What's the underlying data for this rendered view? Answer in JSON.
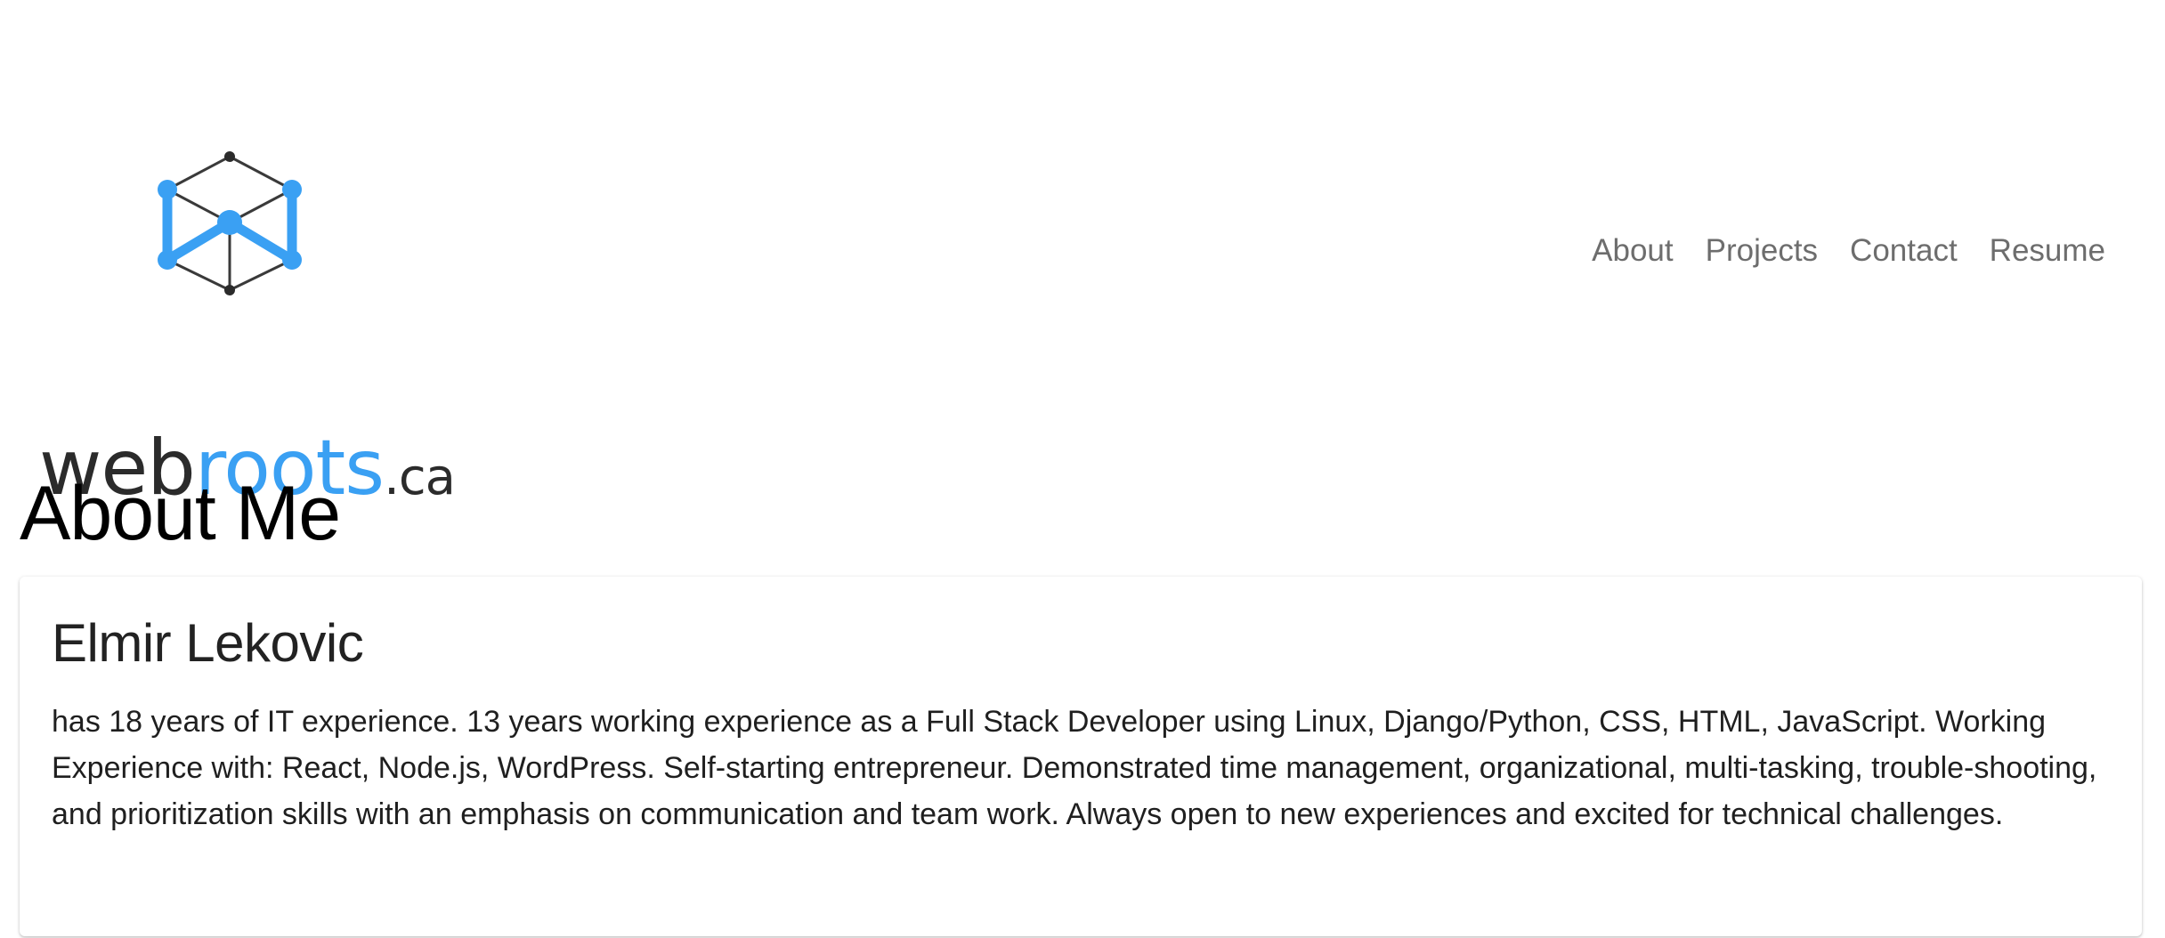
{
  "header": {
    "logo": {
      "text_main": "web",
      "text_accent": "roots",
      "text_suffix": ".ca",
      "icon": "cube-network-icon"
    },
    "nav": [
      {
        "label": "About"
      },
      {
        "label": "Projects"
      },
      {
        "label": "Contact"
      },
      {
        "label": "Resume"
      }
    ]
  },
  "main": {
    "title": "About Me",
    "card": {
      "name": "Elmir Lekovic",
      "bio": "has 18 years of IT experience. 13 years working experience as a Full Stack Developer using Linux, Django/Python, CSS, HTML, JavaScript. Working Experience with: React, Node.js, WordPress. Self-starting entrepreneur. Demonstrated time management, organizational, multi-tasking, trouble-shooting, and prioritization skills with an emphasis on communication and team work. Always open to new experiences and excited for technical challenges."
    }
  },
  "colors": {
    "accent": "#3aa0f3",
    "dark": "#2b2b2b",
    "nav": "#6d6d6d"
  }
}
